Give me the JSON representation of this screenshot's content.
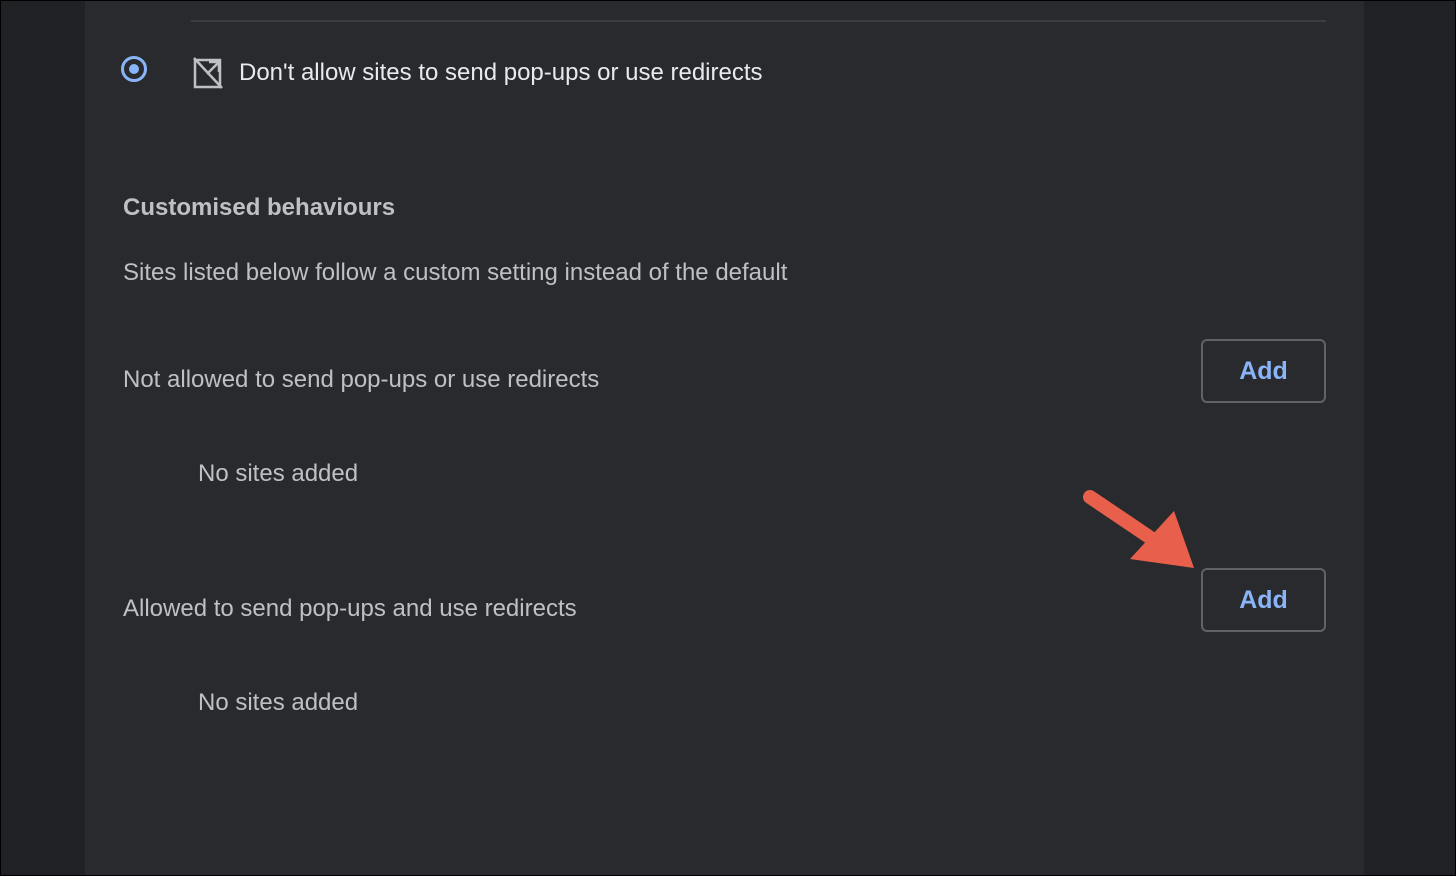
{
  "popups": {
    "block_option": {
      "label": "Don't allow sites to send pop-ups or use redirects",
      "selected": true,
      "icon": "popup-blocked-icon"
    },
    "customised": {
      "heading": "Customised behaviours",
      "description": "Sites listed below follow a custom setting instead of the default"
    },
    "not_allowed": {
      "title": "Not allowed to send pop-ups or use redirects",
      "add_label": "Add",
      "empty_text": "No sites added"
    },
    "allowed": {
      "title": "Allowed to send pop-ups and use redirects",
      "add_label": "Add",
      "empty_text": "No sites added"
    }
  },
  "colors": {
    "accent": "#8ab4f8",
    "annotation_arrow": "#e8604c",
    "panel_bg": "#292a2d",
    "page_bg": "#202124"
  }
}
